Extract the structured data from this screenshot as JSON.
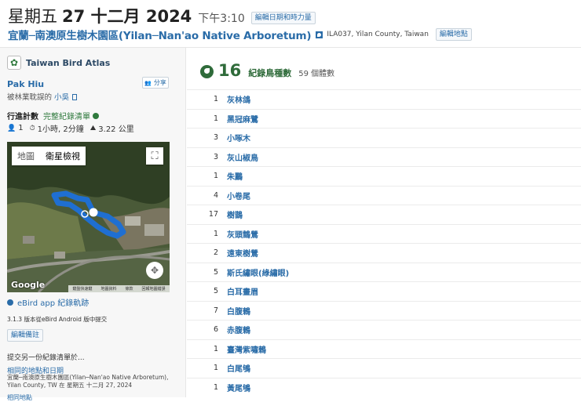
{
  "header": {
    "date_prefix": "星期五",
    "date_main": "27 十二月 2024",
    "time": "下午3:10",
    "edit_date_label": "編輯日期和時力量",
    "location_name": "宜蘭─南澳原生樹木園區(Yilan─Nan'ao Native Arboretum)",
    "location_meta": "ILA037,  Yilan County,  Taiwan",
    "edit_location_label": "編輯地點"
  },
  "sidebar": {
    "portal_name": "Taiwan Bird Atlas",
    "observer": "Pak Hiu",
    "share_label": "分享",
    "shared_by_text": "被林業耽誤的",
    "shared_by_name": "小吳",
    "protocol_label": "行進計數",
    "protocol_complete": "完整紀錄清單",
    "stats": {
      "observers": "1",
      "duration": "1小時, 2分鐘",
      "distance": "3.22 公里"
    },
    "map": {
      "tab_map": "地圖",
      "tab_satellite": "衛星檢視",
      "google": "Google",
      "attribution": [
        "鍵盤快速鍵",
        "地圖資料",
        "條款",
        "回報地圖錯誤"
      ]
    },
    "track_link": "eBird app 紀錄軌跡",
    "submitted": "3.1.3 版本從eBird Android 版中提交",
    "edit_notes": "編輯備註",
    "another_checklist": "提交另一份紀錄清單於...",
    "same_location": "相同的地點和日期",
    "same_desc": "宜蘭─南澳原生樹木園區(Yilan─Nan'ao Native Arboretum), Yilan County, TW 在 星期五 十二月 27, 2024",
    "more_link": "相同地點"
  },
  "summary": {
    "species_count": "16",
    "species_label": "紀錄鳥種數",
    "individuals": "59 個體數"
  },
  "species": [
    {
      "count": "1",
      "name": "灰林鴿"
    },
    {
      "count": "1",
      "name": "黑冠麻鷺"
    },
    {
      "count": "3",
      "name": "小啄木"
    },
    {
      "count": "3",
      "name": "灰山椒鳥"
    },
    {
      "count": "1",
      "name": "朱鸝"
    },
    {
      "count": "4",
      "name": "小卷尾"
    },
    {
      "count": "17",
      "name": "樹鵲"
    },
    {
      "count": "1",
      "name": "灰頭鷦鶯"
    },
    {
      "count": "2",
      "name": "遠東樹鶯"
    },
    {
      "count": "5",
      "name": "斯氏繡眼(綠繡眼)"
    },
    {
      "count": "5",
      "name": "白耳畫眉"
    },
    {
      "count": "7",
      "name": "白腹鶇"
    },
    {
      "count": "6",
      "name": "赤腹鶇"
    },
    {
      "count": "1",
      "name": "臺灣紫嘯鶇"
    },
    {
      "count": "1",
      "name": "白尾鴝"
    },
    {
      "count": "1",
      "name": "黃尾鴝"
    }
  ],
  "colors": {
    "link": "#2a6ca8",
    "accent_green": "#2f6b3a",
    "track": "#1f6fd1"
  }
}
